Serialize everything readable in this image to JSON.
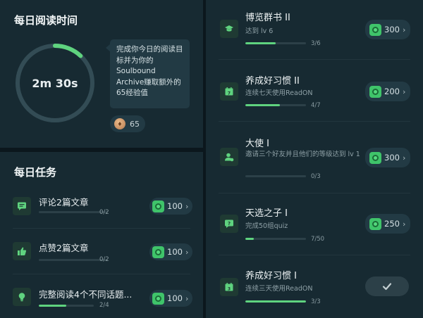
{
  "reading": {
    "title": "每日阅读时间",
    "time": "2m 30s",
    "progress": 0.12,
    "tooltip": "完成你今日的阅读目标并为你的Soulbound Archive赚取额外的65经验值",
    "xp": "65"
  },
  "tasks": {
    "title": "每日任务",
    "items": [
      {
        "name": "评论2篇文章",
        "count": "0/2",
        "progress": 0,
        "reward": "100",
        "icon": "comment-icon"
      },
      {
        "name": "点赞2篇文章",
        "count": "0/2",
        "progress": 0,
        "reward": "100",
        "icon": "thumbs-up-icon"
      },
      {
        "name": "完整阅读4个不同话题...",
        "count": "2/4",
        "progress": 0.5,
        "reward": "100",
        "icon": "lightbulb-icon"
      }
    ]
  },
  "achievements": {
    "items": [
      {
        "name": "博览群书 II",
        "desc": "达到 lv 6",
        "count": "3/6",
        "progress": 0.5,
        "reward": "300",
        "icon": "graduation-cap-icon"
      },
      {
        "name": "养成好习惯 II",
        "desc": "连续七天使用ReadON",
        "count": "4/7",
        "progress": 0.57,
        "reward": "200",
        "icon": "calendar-7-icon"
      },
      {
        "name": "大使 I",
        "desc": "邀请三个好友并且他们的等级达到 lv 1",
        "count": "0/3",
        "progress": 0,
        "reward": "300",
        "icon": "invite-user-icon"
      },
      {
        "name": "天选之子 I",
        "desc": "完成50组quiz",
        "count": "7/50",
        "progress": 0.14,
        "reward": "250",
        "icon": "quiz-icon"
      },
      {
        "name": "养成好习惯 I",
        "desc": "连续三天使用ReadON",
        "count": "3/3",
        "progress": 1,
        "reward": "",
        "icon": "calendar-3-icon",
        "claimed": true
      }
    ]
  },
  "colors": {
    "accent": "#5fd37f",
    "background": "#0e1c23",
    "panel": "#172a32"
  }
}
